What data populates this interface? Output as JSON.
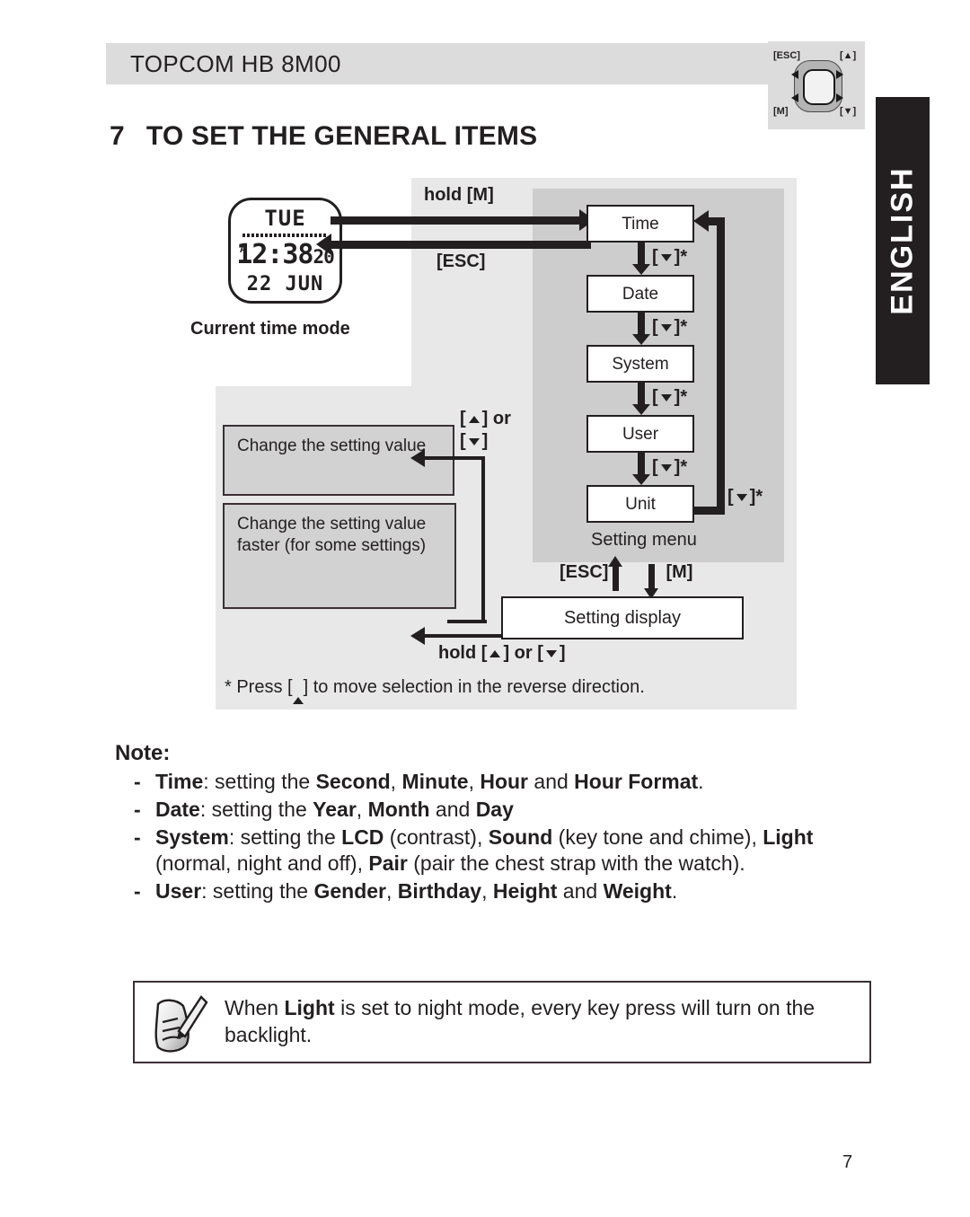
{
  "header": {
    "product_title": "TOPCOM HB 8M00",
    "key_legend": {
      "esc": "[ESC]",
      "up": "[▲]",
      "m": "[M]",
      "down": "[▼]"
    }
  },
  "side_tab": {
    "language": "ENGLISH"
  },
  "section": {
    "number": "7",
    "title": "TO SET THE GENERAL ITEMS"
  },
  "diagram": {
    "lcd": {
      "day_of_week": "TUE",
      "am_pm": "A",
      "time": "12:38",
      "seconds": "20",
      "date": "22 JUN"
    },
    "current_time_mode_label": "Current time mode",
    "enter_label": "hold [M]",
    "exit_label": "[ESC]",
    "menu_title": "Setting menu",
    "menu_items": [
      "Time",
      "Date",
      "System",
      "User",
      "Unit"
    ],
    "step_label": "]*",
    "step_label_prefix": "[",
    "unit_loop_label": "]*",
    "setting_display_label": "Setting display",
    "esc_label": "[ESC]",
    "m_label": "[M]",
    "change_value_label": "Change the setting value",
    "change_value_fast_label": "Change the setting value faster (for some settings)",
    "updown_label_line1": "] or",
    "updown_label_line2": "]",
    "hold_updown_prefix": "hold [",
    "hold_updown_middle": "] or [",
    "hold_updown_suffix": "]",
    "footnote_prefix": "* Press [",
    "footnote_suffix": "] to move selection in the reverse direction."
  },
  "note": {
    "title": "Note:",
    "items": [
      {
        "lead": "Time",
        "parts": [
          {
            "t": ": setting the ",
            "b": false
          },
          {
            "t": "Second",
            "b": true
          },
          {
            "t": ", ",
            "b": false
          },
          {
            "t": "Minute",
            "b": true
          },
          {
            "t": ", ",
            "b": false
          },
          {
            "t": "Hour",
            "b": true
          },
          {
            "t": " and ",
            "b": false
          },
          {
            "t": "Hour Format",
            "b": true
          },
          {
            "t": ".",
            "b": false
          }
        ]
      },
      {
        "lead": "Date",
        "parts": [
          {
            "t": ": setting the ",
            "b": false
          },
          {
            "t": "Year",
            "b": true
          },
          {
            "t": ", ",
            "b": false
          },
          {
            "t": "Month",
            "b": true
          },
          {
            "t": " and ",
            "b": false
          },
          {
            "t": "Day",
            "b": true
          }
        ]
      },
      {
        "lead": "System",
        "parts": [
          {
            "t": ": setting the ",
            "b": false
          },
          {
            "t": "LCD",
            "b": true
          },
          {
            "t": " (contrast), ",
            "b": false
          },
          {
            "t": "Sound",
            "b": true
          },
          {
            "t": " (key tone and chime), ",
            "b": false
          },
          {
            "t": "Light",
            "b": true
          },
          {
            "t": " (normal, night and off), ",
            "b": false
          },
          {
            "t": "Pair",
            "b": true
          },
          {
            "t": " (pair the chest strap with the watch).",
            "b": false
          }
        ]
      },
      {
        "lead": "User",
        "parts": [
          {
            "t": ": setting the ",
            "b": false
          },
          {
            "t": "Gender",
            "b": true
          },
          {
            "t": ", ",
            "b": false
          },
          {
            "t": "Birthday",
            "b": true
          },
          {
            "t": ", ",
            "b": false
          },
          {
            "t": "Height",
            "b": true
          },
          {
            "t": " and ",
            "b": false
          },
          {
            "t": "Weight",
            "b": true
          },
          {
            "t": ".",
            "b": false
          }
        ]
      }
    ],
    "bullet": "-"
  },
  "tip": {
    "parts": [
      {
        "t": "When ",
        "b": false
      },
      {
        "t": "Light",
        "b": true
      },
      {
        "t": " is set to night mode, every key press will turn on the backlight.",
        "b": false
      }
    ]
  },
  "footer": {
    "page_number": "7"
  },
  "colors": {
    "ink": "#231f20",
    "header_bar": "#dcdcdc",
    "panel_light": "#e8e8e8",
    "panel_dark": "#cdcdcd",
    "infobox_fill": "#d2d2d2",
    "tab_fill": "#231f20"
  }
}
